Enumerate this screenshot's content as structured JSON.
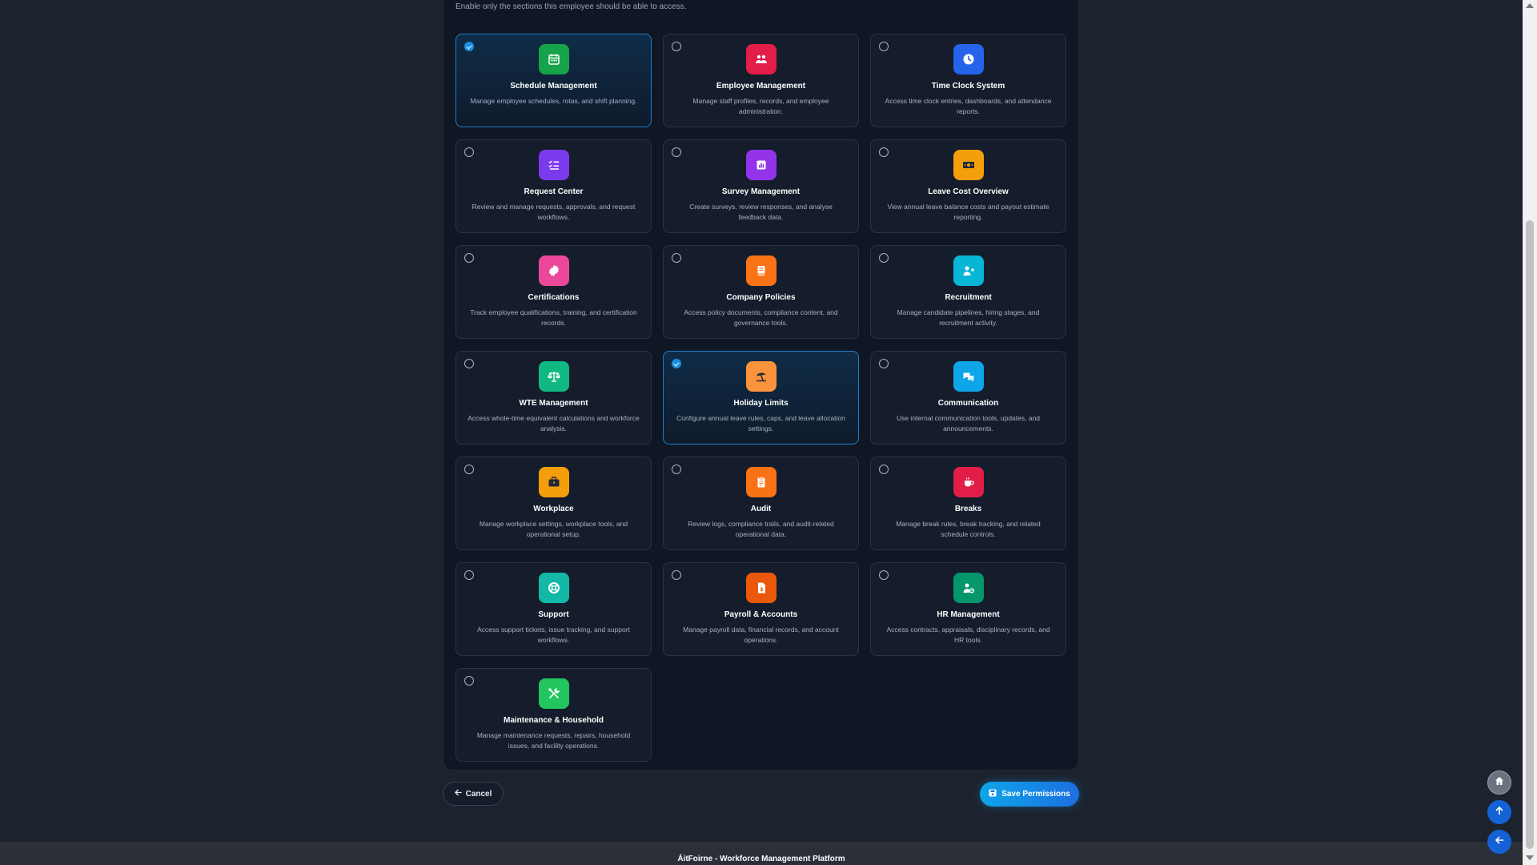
{
  "intro_text": "Enable only the sections this employee should be able to access.",
  "modules": [
    {
      "title": "Schedule Management",
      "desc": "Manage employee schedules, rotas, and shift planning.",
      "icon": "calendar-icon",
      "color": "#16a34a",
      "selected": true
    },
    {
      "title": "Employee Management",
      "desc": "Manage staff profiles, records, and employee administration.",
      "icon": "users-icon",
      "color": "#e11d48",
      "selected": false
    },
    {
      "title": "Time Clock System",
      "desc": "Access time clock entries, dashboards, and attendance reports.",
      "icon": "clock-icon",
      "color": "#2563eb",
      "selected": false
    },
    {
      "title": "Request Center",
      "desc": "Review and manage requests, approvals, and request workflows.",
      "icon": "list-check-icon",
      "color": "#7c3aed",
      "selected": false
    },
    {
      "title": "Survey Management",
      "desc": "Create surveys, review responses, and analyse feedback data.",
      "icon": "chart-icon",
      "color": "#9333ea",
      "selected": false
    },
    {
      "title": "Leave Cost Overview",
      "desc": "View annual leave balance costs and payout estimate reporting.",
      "icon": "money-icon",
      "color": "#f59e0b",
      "selected": false
    },
    {
      "title": "Certifications",
      "desc": "Track employee qualifications, training, and certification records.",
      "icon": "certificate-icon",
      "color": "#ec4899",
      "selected": false
    },
    {
      "title": "Company Policies",
      "desc": "Access policy documents, compliance content, and governance tools.",
      "icon": "book-icon",
      "color": "#f97316",
      "selected": false
    },
    {
      "title": "Recruitment",
      "desc": "Manage candidate pipelines, hiring stages, and recruitment activity.",
      "icon": "user-plus-icon",
      "color": "#06b6d4",
      "selected": false
    },
    {
      "title": "WTE Management",
      "desc": "Access whole-time equivalent calculations and workforce analysis.",
      "icon": "scale-icon",
      "color": "#10b981",
      "selected": false
    },
    {
      "title": "Holiday Limits",
      "desc": "Configure annual leave rules, caps, and leave allocation settings.",
      "icon": "umbrella-beach-icon",
      "color": "#fb923c",
      "selected": true
    },
    {
      "title": "Communication",
      "desc": "Use internal communication tools, updates, and announcements.",
      "icon": "chat-icon",
      "color": "#0ea5e9",
      "selected": false
    },
    {
      "title": "Workplace",
      "desc": "Manage workplace settings, workplace tools, and operational setup.",
      "icon": "briefcase-icon",
      "color": "#f59e0b",
      "selected": false
    },
    {
      "title": "Audit",
      "desc": "Review logs, compliance trails, and audit-related operational data.",
      "icon": "clipboard-icon",
      "color": "#f97316",
      "selected": false
    },
    {
      "title": "Breaks",
      "desc": "Manage break rules, break tracking, and related schedule controls.",
      "icon": "coffee-icon",
      "color": "#e11d48",
      "selected": false
    },
    {
      "title": "Support",
      "desc": "Access support tickets, issue tracking, and support workflows.",
      "icon": "lifebuoy-icon",
      "color": "#14b8a6",
      "selected": false
    },
    {
      "title": "Payroll & Accounts",
      "desc": "Manage payroll data, financial records, and account operations.",
      "icon": "invoice-icon",
      "color": "#ea580c",
      "selected": false
    },
    {
      "title": "HR Management",
      "desc": "Access contracts, appraisals, disciplinary records, and HR tools.",
      "icon": "user-gear-icon",
      "color": "#059669",
      "selected": false
    },
    {
      "title": "Maintenance & Household",
      "desc": "Manage maintenance requests, repairs, household issues, and facility operations.",
      "icon": "tools-icon",
      "color": "#22c55e",
      "selected": false
    }
  ],
  "buttons": {
    "cancel": "Cancel",
    "save": "Save Permissions"
  },
  "footer_text": "ÁitFoirne - Workforce Management Platform",
  "fabs": {
    "home_icon": "home-icon",
    "up_icon": "arrow-up-icon",
    "back_icon": "arrow-left-icon"
  }
}
